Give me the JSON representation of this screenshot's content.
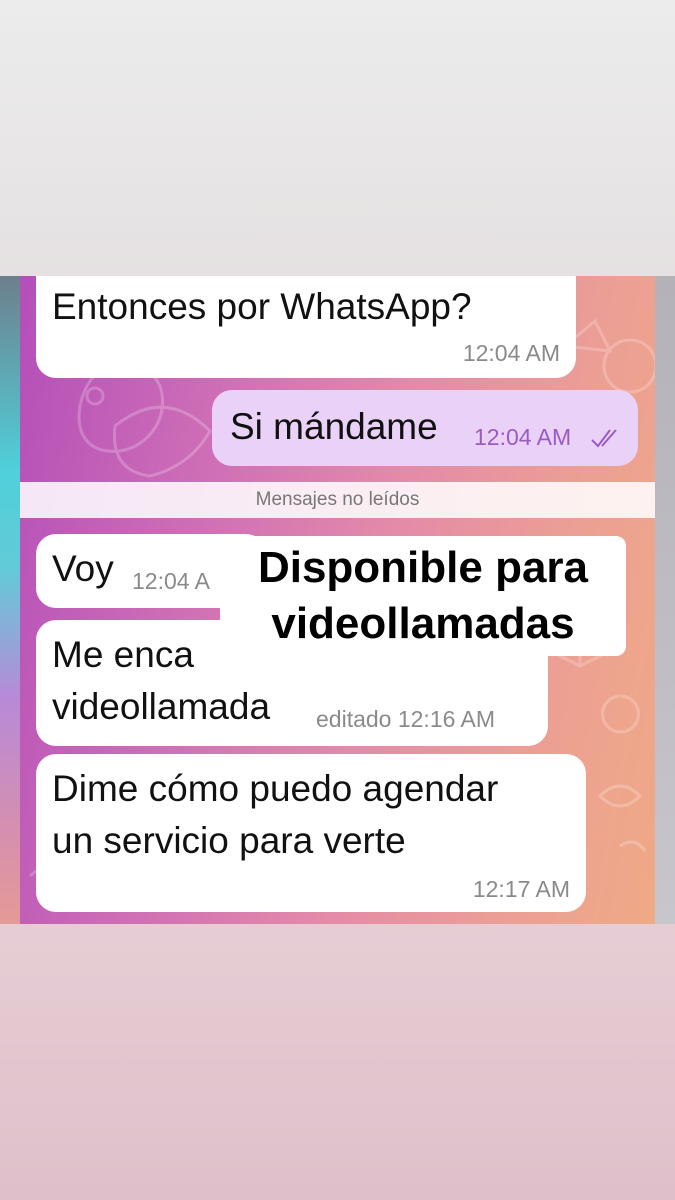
{
  "chat": {
    "messages": [
      {
        "text_lines": [
          "Entonces por WhatsApp?"
        ],
        "time": "12:04 AM",
        "direction": "incoming"
      },
      {
        "text_lines": [
          "Si mándame"
        ],
        "time": "12:04 AM",
        "direction": "outgoing",
        "status_icon": "double-check-icon"
      },
      {
        "text_lines": [
          "Voy"
        ],
        "time": "12:04 A",
        "direction": "incoming"
      },
      {
        "text_lines": [
          "Me encantó la",
          "videollamada"
        ],
        "time": "editado 12:16 AM",
        "direction": "incoming",
        "visible_first_line": "Me enca"
      },
      {
        "text_lines": [
          "Dime cómo puedo agendar",
          "un servicio para verte"
        ],
        "time": "12:17 AM",
        "direction": "incoming"
      }
    ],
    "unread_divider": "Mensajes no leídos"
  },
  "overlay": {
    "line1": "Disponible para",
    "line2": "videollamadas"
  },
  "colors": {
    "incoming_bubble": "#ffffff",
    "outgoing_bubble": "#ead1f7",
    "outgoing_time": "#9a5cc4",
    "timestamp": "#8a8a8a",
    "wallpaper_start": "#b44fb9",
    "wallpaper_end": "#efaa86"
  }
}
